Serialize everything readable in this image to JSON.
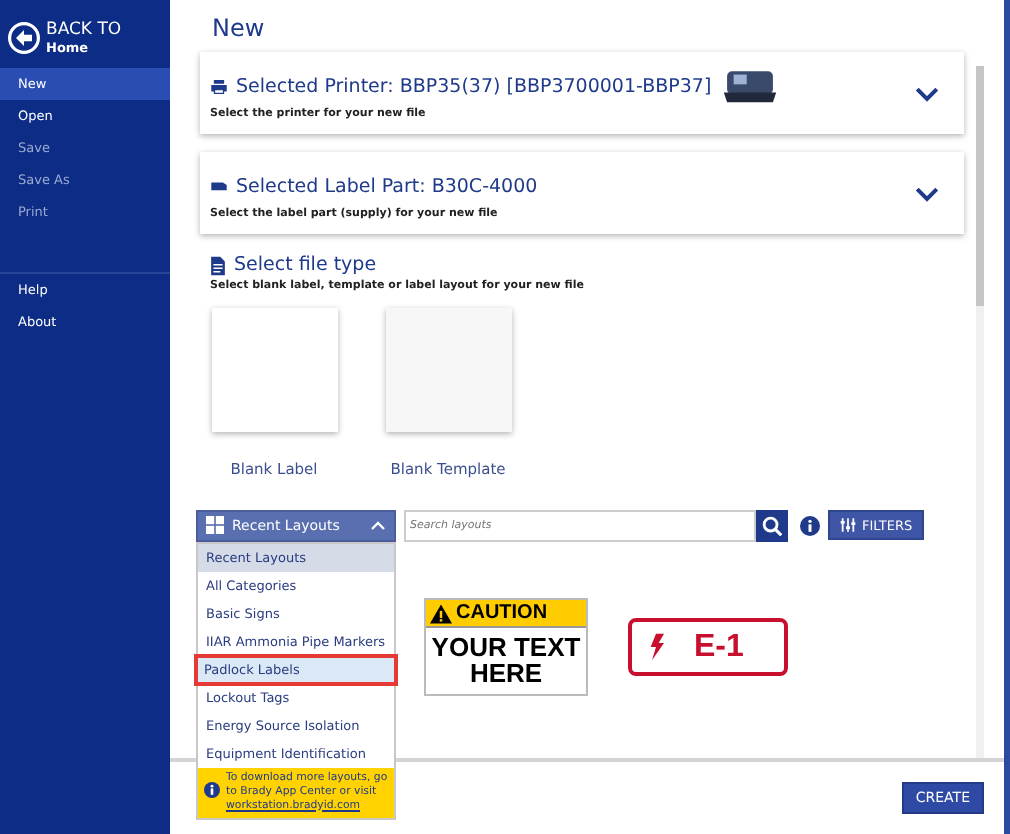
{
  "sidebar": {
    "back": {
      "title": "BACK TO",
      "subtitle": "Home"
    },
    "items": [
      {
        "label": "New",
        "selected": true,
        "disabled": false
      },
      {
        "label": "Open",
        "selected": false,
        "disabled": false
      },
      {
        "label": "Save",
        "selected": false,
        "disabled": true
      },
      {
        "label": "Save As",
        "selected": false,
        "disabled": true
      },
      {
        "label": "Print",
        "selected": false,
        "disabled": true
      }
    ],
    "footer_items": [
      {
        "label": "Help",
        "selected": false,
        "disabled": false
      },
      {
        "label": "About",
        "selected": false,
        "disabled": false
      }
    ]
  },
  "page_title": "New",
  "cards": [
    {
      "kind": "printer",
      "title": "Selected Printer: BBP35(37) [BBP3700001-BBP37]",
      "subtitle": "Select the printer for your new file",
      "expanded": false
    },
    {
      "kind": "label",
      "title": "Selected Label Part: B30C-4000",
      "subtitle": "Select the label part (supply) for your new file",
      "expanded": false
    }
  ],
  "file_type": {
    "title": "Select file type",
    "subtitle": "Select blank label, template or label layout for your new file",
    "tiles": [
      {
        "label": "Blank Label"
      },
      {
        "label": "Blank Template"
      }
    ]
  },
  "layouts": {
    "dropdown": {
      "value": "Recent Layouts",
      "expanded": true,
      "options": [
        {
          "label": "Recent Layouts",
          "selected": true,
          "hovered": false,
          "annotated": false
        },
        {
          "label": "All Categories",
          "selected": false,
          "hovered": false,
          "annotated": false
        },
        {
          "label": "Basic Signs",
          "selected": false,
          "hovered": false,
          "annotated": false
        },
        {
          "label": "IIAR Ammonia Pipe Markers",
          "selected": false,
          "hovered": false,
          "annotated": false
        },
        {
          "label": "Padlock Labels",
          "selected": false,
          "hovered": true,
          "annotated": true
        },
        {
          "label": "Lockout Tags",
          "selected": false,
          "hovered": false,
          "annotated": false
        },
        {
          "label": "Energy Source Isolation",
          "selected": false,
          "hovered": false,
          "annotated": false
        },
        {
          "label": "Equipment Identification",
          "selected": false,
          "hovered": false,
          "annotated": false
        }
      ],
      "note": "To download more layouts, go to Brady App Center or visit",
      "note_link": "workstation.bradyid.com"
    },
    "search": {
      "placeholder": "Search layouts"
    },
    "filters_button": "FILTERS",
    "thumbnails": [
      {
        "kind": "caution",
        "header": "CAUTION",
        "body": "YOUR TEXT HERE"
      },
      {
        "kind": "energy",
        "body": "E-1"
      }
    ]
  },
  "create_button": "CREATE"
}
